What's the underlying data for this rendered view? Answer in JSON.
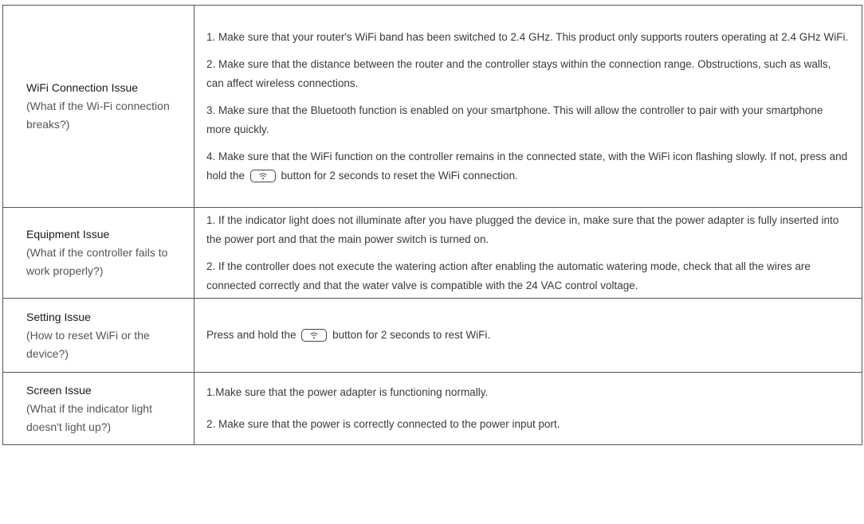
{
  "rows": [
    {
      "title": "WiFi Connection Issue",
      "question": "(What if the Wi-Fi connection breaks?)",
      "answers": [
        "1. Make sure that your router's WiFi band has been switched to 2.4 GHz. This product only supports routers operating at 2.4 GHz WiFi.",
        "2. Make sure that the distance between the router and the controller stays within the connection range. Obstructions, such as walls, can affect wireless connections.",
        "3. Make sure that the Bluetooth function is enabled on your smartphone. This will allow the controller to pair with your smartphone more quickly.",
        {
          "before": "4. Make sure that the WiFi function on the controller remains in the connected state, with the WiFi icon flashing slowly. If not, press and hold the",
          "after": "button for 2 seconds to reset the WiFi connection."
        }
      ]
    },
    {
      "title": "Equipment Issue",
      "question": "(What if the controller fails to work properly?)",
      "answers": [
        "1. If the indicator light does not illuminate after you have plugged the device in, make sure that the power adapter is fully inserted into the power port and that the main power switch is turned on.",
        "2. If the controller does not execute the watering action after enabling the automatic watering mode, check that all the wires are connected correctly and that the water valve is compatible with the 24 VAC control voltage."
      ]
    },
    {
      "title": "Setting Issue",
      "question": "(How to reset WiFi or the device?)",
      "answer": {
        "before": "Press and hold the",
        "after": "button for 2 seconds to rest WiFi."
      }
    },
    {
      "title": "Screen Issue",
      "question": "(What if the indicator light doesn't light up?)",
      "answers": [
        "1.Make sure that the power adapter  is functioning normally.",
        "2. Make sure that the power is correctly connected to the power input port."
      ]
    }
  ],
  "icons": {
    "wifi_button": "wifi-button-icon"
  }
}
